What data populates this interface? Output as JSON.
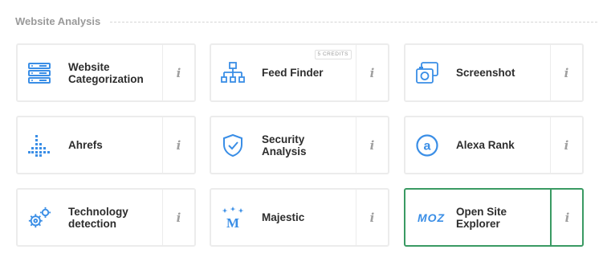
{
  "section": {
    "title": "Website Analysis"
  },
  "cards": [
    {
      "label": "Website Categorization",
      "icon": "server-stack-icon",
      "info": "i"
    },
    {
      "label": "Feed Finder",
      "icon": "sitemap-icon",
      "info": "i",
      "badge": "5 CREDITS"
    },
    {
      "label": "Screenshot",
      "icon": "screenshot-camera-icon",
      "info": "i"
    },
    {
      "label": "Ahrefs",
      "icon": "ahrefs-logo-icon",
      "info": "i"
    },
    {
      "label": "Security Analysis",
      "icon": "shield-check-icon",
      "info": "i"
    },
    {
      "label": "Alexa Rank",
      "icon": "alexa-logo-icon",
      "info": "i"
    },
    {
      "label": "Technology detection",
      "icon": "gears-icon",
      "info": "i"
    },
    {
      "label": "Majestic",
      "icon": "majestic-logo-icon",
      "info": "i"
    },
    {
      "label": "Open Site Explorer",
      "icon": "moz-logo-icon",
      "info": "i",
      "selected": true
    }
  ],
  "colors": {
    "accent": "#3a8ee6",
    "selected_border": "#3a9a63",
    "title": "#9a9a9a"
  },
  "logos": {
    "moz": "MOZ",
    "majestic": "M",
    "alexa": "a"
  }
}
